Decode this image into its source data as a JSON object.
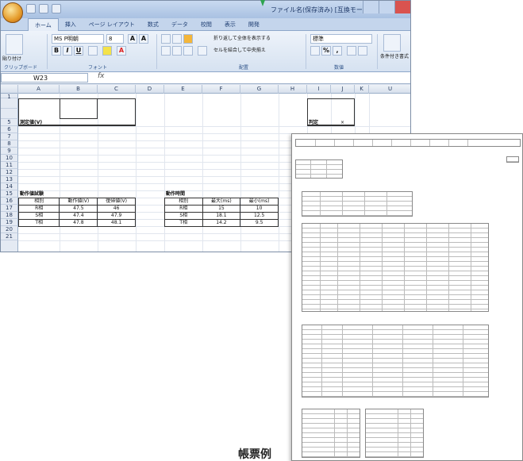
{
  "window": {
    "title": "ファイル名(保存済み) [互換モード] - Microsoft Excel"
  },
  "tabs": [
    "ホーム",
    "挿入",
    "ページ レイアウト",
    "数式",
    "データ",
    "校閲",
    "表示",
    "開発"
  ],
  "ribbon": {
    "paste_label": "貼り付け",
    "clipboard_group": "クリップボード",
    "font_name": "MS P明朝",
    "font_size": "8",
    "font_group": "フォント",
    "align_group": "配置",
    "wrap_label": "折り返して全体を表示する",
    "merge_label": "セルを結合して中央揃え",
    "number_format": "標準",
    "number_group": "数値",
    "cond_label": "条件付き書式"
  },
  "formula_bar": {
    "name_box": "W23",
    "fx": "fx"
  },
  "columns": [
    "A",
    "B",
    "C",
    "D",
    "E",
    "F",
    "G",
    "H",
    "I",
    "J",
    "K",
    "U"
  ],
  "rows": [
    "1",
    "5",
    "6",
    "7",
    "8",
    "9",
    "10",
    "11",
    "12",
    "13",
    "14",
    "15",
    "16",
    "17",
    "18",
    "19",
    "20",
    "21"
  ],
  "sheet": {
    "measured_label": "測定値(V)",
    "judge_label": "判定",
    "judge_value": "×",
    "t1": {
      "title": "動作値試験",
      "headers": [
        "相別",
        "動作値(V)",
        "復帰値(V)"
      ],
      "rows": [
        [
          "R相",
          "47.5",
          "46"
        ],
        [
          "S相",
          "47.4",
          "47.9"
        ],
        [
          "T相",
          "47.8",
          "48.1"
        ]
      ]
    },
    "t2": {
      "title": "動作時間",
      "headers": [
        "相別",
        "最大(ms)",
        "最小(ms)"
      ],
      "rows": [
        [
          "R相",
          "15",
          "10"
        ],
        [
          "S相",
          "18.1",
          "12.5"
        ],
        [
          "T相",
          "14.2",
          "9.5"
        ]
      ]
    }
  },
  "report": {
    "caption": "帳票例"
  },
  "colors": {
    "accent": "#2e6bc6",
    "arrow": "#2ea44f"
  }
}
